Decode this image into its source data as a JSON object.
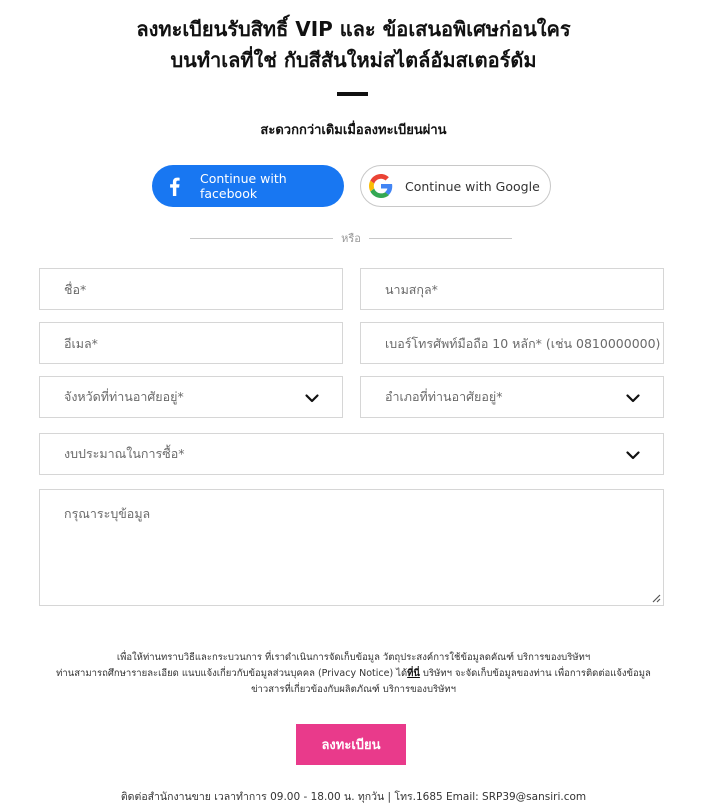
{
  "header": {
    "title_line1": "ลงทะเบียนรับสิทธิ์ VIP และ ข้อเสนอพิเศษก่อนใคร",
    "title_line2": "บนทำเลที่ใช่ กับสีสันใหม่สไตล์อัมสเตอร์ดัม",
    "subtitle": "สะดวกกว่าเดิมเมื่อลงทะเบียนผ่าน"
  },
  "social": {
    "facebook_label": "Continue with facebook",
    "google_label": "Continue with Google",
    "facebook_color": "#1877f2"
  },
  "separator": {
    "or_text": "หรือ"
  },
  "form": {
    "first_name_placeholder": "ชื่อ*",
    "last_name_placeholder": "นามสกุล*",
    "email_placeholder": "อีเมล*",
    "phone_placeholder": "เบอร์โทรศัพท์มือถือ 10 หลัก* (เช่น 0810000000)",
    "province_label": "จังหวัดที่ท่านอาศัยอยู่*",
    "district_label": "อำเภอที่ท่านอาศัยอยู่*",
    "budget_label": "งบประมาณในการซื้อ*",
    "message_placeholder": "กรุณาระบุข้อมูล"
  },
  "notice": {
    "line1": "เพื่อให้ท่านทราบวิธีและกระบวนการ ที่เราดำเนินการจัดเก็บข้อมูล วัตถุประสงค์การใช้ข้อมูลดคัณฑ์ บริการของบริษัทฯ",
    "line2_pre": "ท่านสามารถศึกษารายละเอียด แนบแจ้งเกี่ยวกับข้อมูลส่วนบุคคล (Privacy Notice) ได้",
    "line2_link": "ที่นี่",
    "line2_post": " บริษัทฯ จะจัดเก็บข้อมูลของท่าน เพื่อการติดต่อแจ้งข้อมูล",
    "line3": "ข่าวสารที่เกี่ยวข้องกับผลิตภัณฑ์ บริการของบริษัทฯ"
  },
  "submit": {
    "label": "ลงทะเบียน",
    "color": "#e93a8b"
  },
  "footer": {
    "text": "ติดต่อสำนักงานขาย เวลาทำการ 09.00 - 18.00 น. ทุกวัน | โทร.1685 Email: SRP39@sansiri.com"
  }
}
